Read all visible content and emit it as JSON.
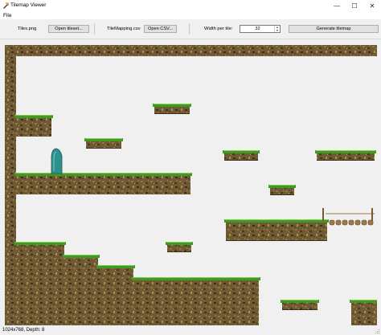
{
  "window": {
    "title": "Tilemap Viewer",
    "minimize_glyph": "—",
    "maximize_glyph": "☐",
    "close_glyph": "✕"
  },
  "menu": {
    "file": "File"
  },
  "toolbar": {
    "tileset_file": "Tiles.png",
    "open_tileset": "Open tileset...",
    "mapping_file": "TileMapping.csv",
    "open_csv": "Open CSV...",
    "width_label": "Width per tile:",
    "width_value": "32",
    "generate": "Generate tilemap"
  },
  "status": {
    "text": "1024x768, Depth: 8"
  },
  "icons": [
    "app-icon",
    "minimize-icon",
    "maximize-icon",
    "close-icon",
    "spin-up-icon",
    "spin-down-icon",
    "size-grip-icon"
  ],
  "colors": {
    "dirt": "#6f5a34",
    "dirt_dark": "#3d2e18",
    "grass": "#3f9a22",
    "grass_light": "#7ed04a",
    "crystal": "#2f8f8a",
    "rope": "#9a7a4a",
    "viewport_bg": "#f0f0f0"
  }
}
